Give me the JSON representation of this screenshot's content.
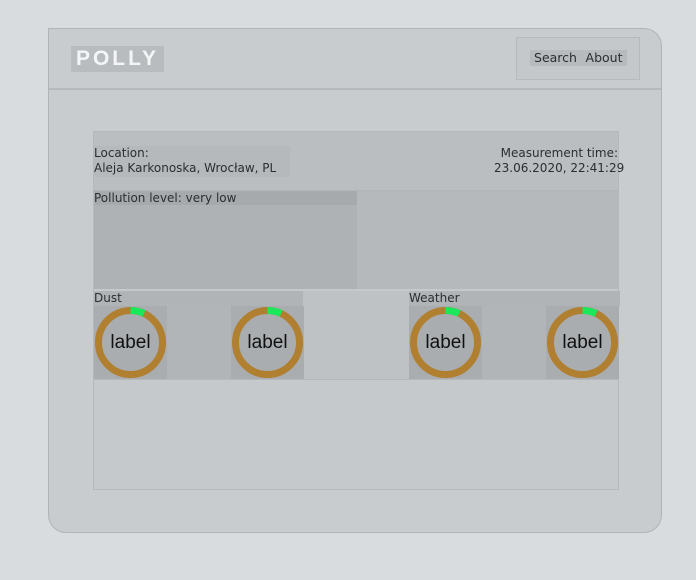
{
  "header": {
    "logo": "POLLY",
    "nav": {
      "search": "Search",
      "about": "About"
    }
  },
  "measurement": {
    "location_label": "Location:",
    "location_value": "Aleja Karkonoska, Wrocław, PL",
    "time_label": "Measurement time:",
    "time_value": "23.06.2020, 22:41:29",
    "pollution": "Pollution level: very low"
  },
  "sections": {
    "dust": {
      "title": "Dust",
      "gauges": [
        {
          "label": "label",
          "fraction": 0.07
        },
        {
          "label": "label",
          "fraction": 0.07
        }
      ]
    },
    "weather": {
      "title": "Weather",
      "gauges": [
        {
          "label": "label",
          "fraction": 0.07
        },
        {
          "label": "label",
          "fraction": 0.07
        }
      ]
    }
  },
  "colors": {
    "gauge_track": "#b07f30",
    "gauge_fill": "#18e85a"
  }
}
